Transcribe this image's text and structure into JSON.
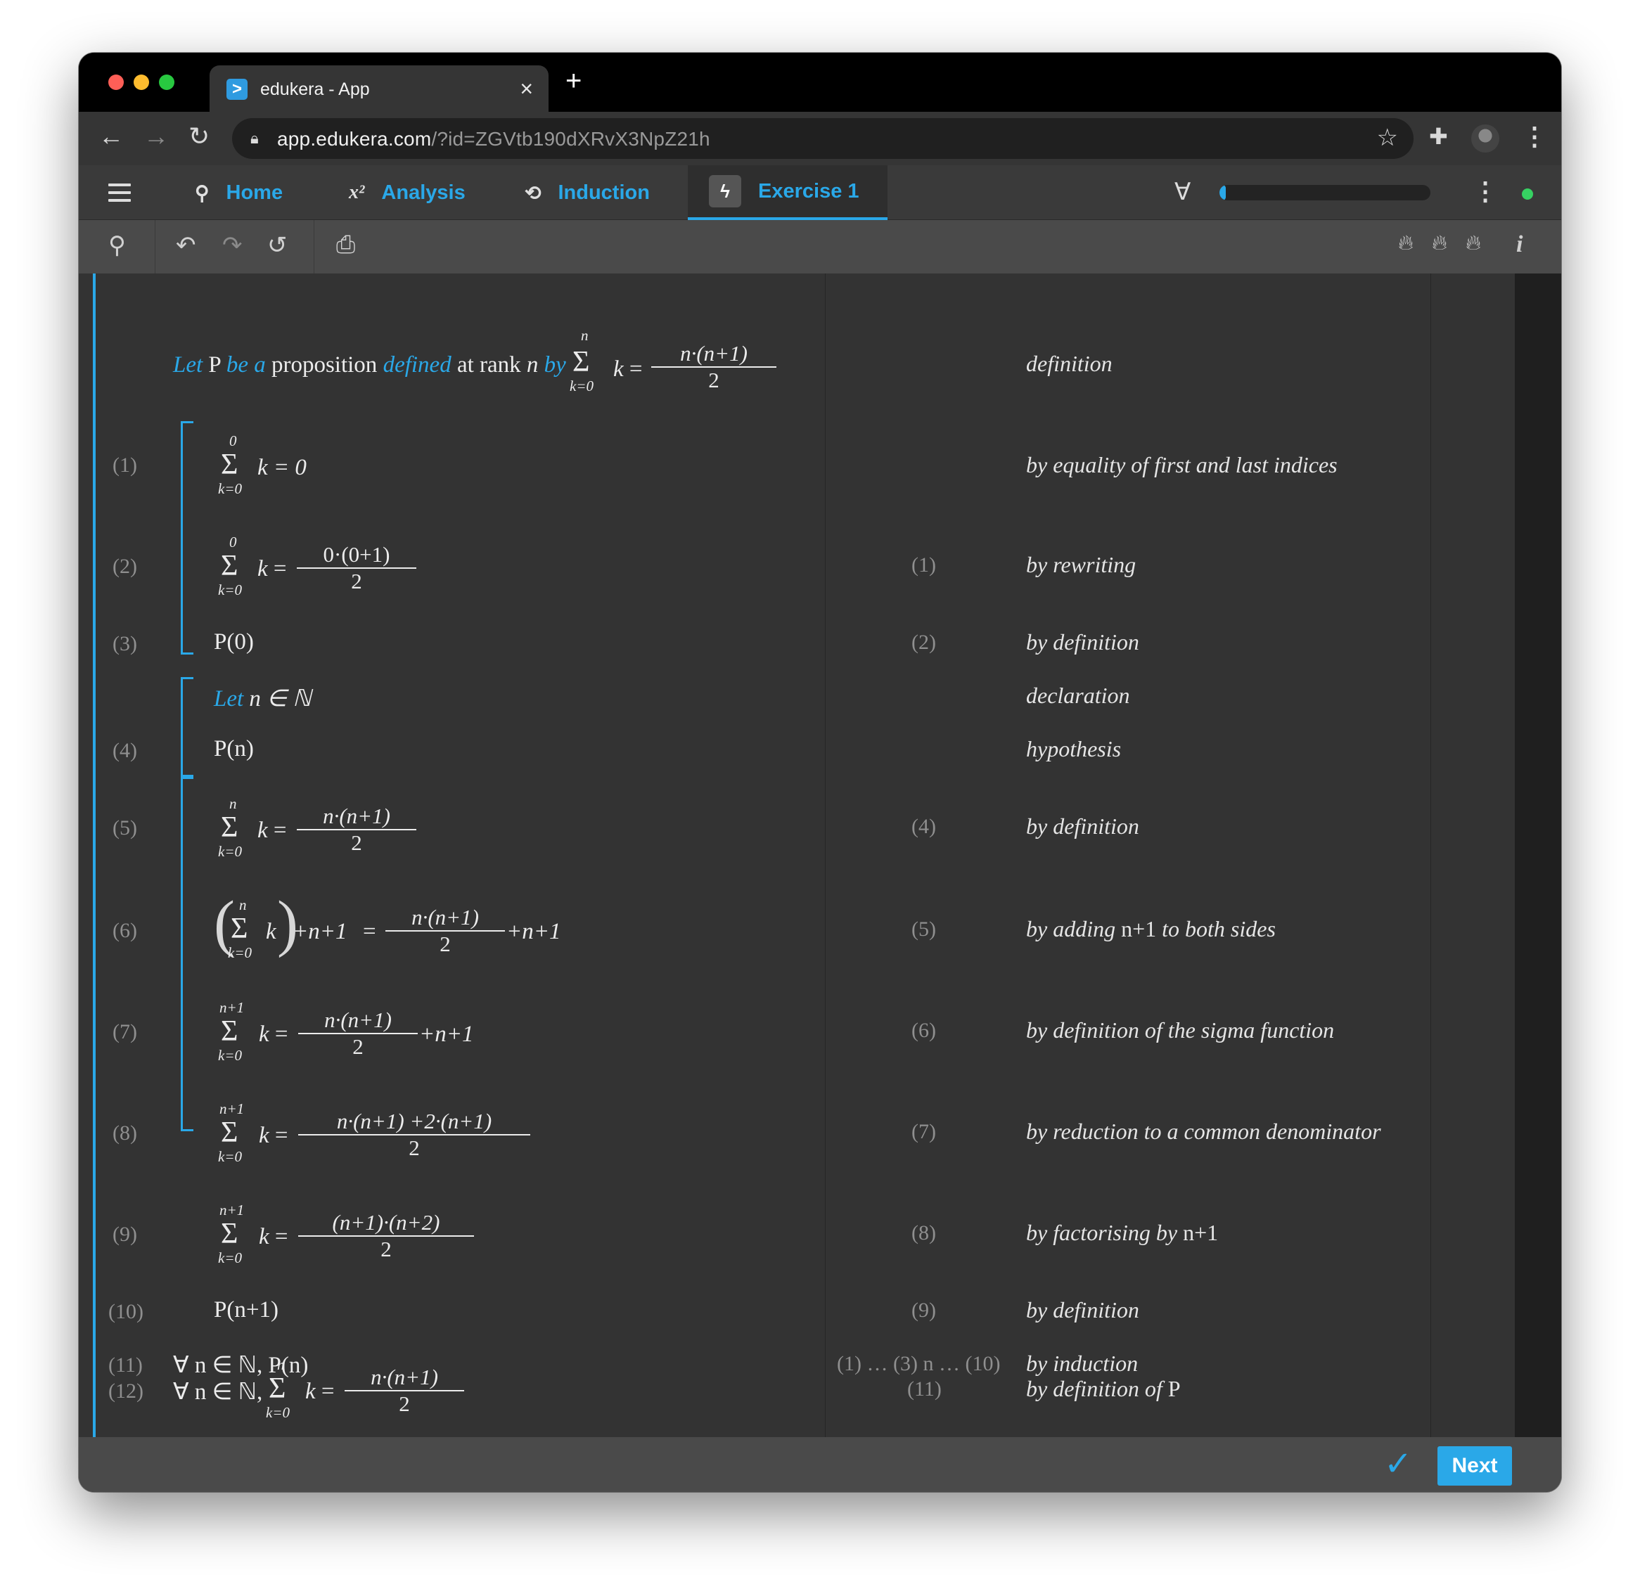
{
  "browser": {
    "tab_title": "edukera - App",
    "url_host": "app.edukera.com",
    "url_path": "/?id=ZGVtb190dXRvX3NpZ21h"
  },
  "nav": {
    "items": [
      {
        "label": "Home",
        "icon": "location-pin-icon"
      },
      {
        "label": "Analysis",
        "icon": "x-squared-icon"
      },
      {
        "label": "Induction",
        "icon": "loop-icon"
      },
      {
        "label": "Exercise 1",
        "icon": "lightning-icon",
        "active": true
      }
    ],
    "progress": 0.03
  },
  "proof": {
    "intro": {
      "let": "Let",
      "P": "P",
      "be_a": "be a",
      "proposition": "proposition",
      "defined": "defined",
      "at_rank": "at rank",
      "n": "n",
      "by": "by",
      "just": "definition"
    },
    "sum": {
      "sigma": "Σ",
      "lower": "k=0",
      "k": "k",
      "eq": "="
    },
    "rows": [
      {
        "label": "(1)",
        "ref": "",
        "just": "by equality of first and last indices",
        "top": "0",
        "expr": "k = 0"
      },
      {
        "label": "(2)",
        "ref": "(1)",
        "just": "by rewriting",
        "top": "0",
        "num": "0·(0+1)",
        "den": "2"
      },
      {
        "label": "(3)",
        "ref": "(2)",
        "just": "by definition",
        "expr": "P(0)"
      },
      {
        "label": "",
        "ref": "",
        "just": "declaration",
        "let": "Let",
        "expr": "n ∈ ℕ"
      },
      {
        "label": "(4)",
        "ref": "",
        "just": "hypothesis",
        "expr": "P(n)"
      },
      {
        "label": "(5)",
        "ref": "(4)",
        "just": "by definition",
        "top": "n",
        "num": "n·(n+1)",
        "den": "2"
      },
      {
        "label": "(6)",
        "ref": "(5)",
        "just_pre": "by adding",
        "just_term": "n+1",
        "just_post": "to both sides",
        "top": "n",
        "lhs_tail": "+n+1",
        "num": "n·(n+1)",
        "den": "2",
        "rhs_tail": "+n+1"
      },
      {
        "label": "(7)",
        "ref": "(6)",
        "just": "by definition of the sigma function",
        "top": "n+1",
        "num": "n·(n+1)",
        "den": "2",
        "rhs_tail": "+n+1"
      },
      {
        "label": "(8)",
        "ref": "(7)",
        "just": "by reduction to a common denominator",
        "top": "n+1",
        "num": "n·(n+1) +2·(n+1)",
        "den": "2"
      },
      {
        "label": "(9)",
        "ref": "(8)",
        "just_pre": "by factorising by",
        "just_term": "n+1",
        "top": "n+1",
        "num": "(n+1)·(n+2)",
        "den": "2"
      },
      {
        "label": "(10)",
        "ref": "(9)",
        "just": "by definition",
        "expr": "P(n+1)"
      },
      {
        "label": "(11)",
        "ref": "(1) … (3)  n … (10)",
        "just": "by induction",
        "expr": "∀ n ∈ ℕ, P(n)"
      },
      {
        "label": "(12)",
        "ref": "(11)",
        "just_pre": "by definition of",
        "just_term": "P",
        "prefix": "∀ n ∈ ℕ,",
        "top": "n",
        "num": "n·(n+1)",
        "den": "2"
      }
    ]
  },
  "footer": {
    "next_label": "Next"
  },
  "colors": {
    "accent": "#2aa8e8",
    "background": "#333333",
    "status": "#36d162"
  }
}
